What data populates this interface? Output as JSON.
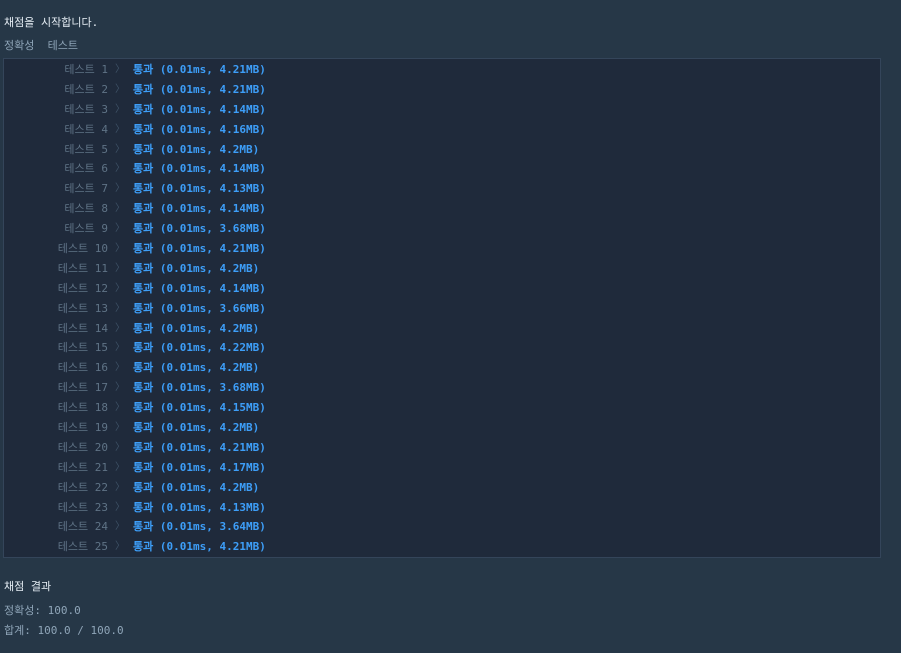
{
  "header": "채점을 시작합니다.",
  "section_label": "정확성  테스트",
  "chevron_icon": "chevron-right-icon",
  "tests": [
    {
      "label": "테스트 1",
      "result": "통과 (0.01ms, 4.21MB)"
    },
    {
      "label": "테스트 2",
      "result": "통과 (0.01ms, 4.21MB)"
    },
    {
      "label": "테스트 3",
      "result": "통과 (0.01ms, 4.14MB)"
    },
    {
      "label": "테스트 4",
      "result": "통과 (0.01ms, 4.16MB)"
    },
    {
      "label": "테스트 5",
      "result": "통과 (0.01ms, 4.2MB)"
    },
    {
      "label": "테스트 6",
      "result": "통과 (0.01ms, 4.14MB)"
    },
    {
      "label": "테스트 7",
      "result": "통과 (0.01ms, 4.13MB)"
    },
    {
      "label": "테스트 8",
      "result": "통과 (0.01ms, 4.14MB)"
    },
    {
      "label": "테스트 9",
      "result": "통과 (0.01ms, 3.68MB)"
    },
    {
      "label": "테스트 10",
      "result": "통과 (0.01ms, 4.21MB)"
    },
    {
      "label": "테스트 11",
      "result": "통과 (0.01ms, 4.2MB)"
    },
    {
      "label": "테스트 12",
      "result": "통과 (0.01ms, 4.14MB)"
    },
    {
      "label": "테스트 13",
      "result": "통과 (0.01ms, 3.66MB)"
    },
    {
      "label": "테스트 14",
      "result": "통과 (0.01ms, 4.2MB)"
    },
    {
      "label": "테스트 15",
      "result": "통과 (0.01ms, 4.22MB)"
    },
    {
      "label": "테스트 16",
      "result": "통과 (0.01ms, 4.2MB)"
    },
    {
      "label": "테스트 17",
      "result": "통과 (0.01ms, 3.68MB)"
    },
    {
      "label": "테스트 18",
      "result": "통과 (0.01ms, 4.15MB)"
    },
    {
      "label": "테스트 19",
      "result": "통과 (0.01ms, 4.2MB)"
    },
    {
      "label": "테스트 20",
      "result": "통과 (0.01ms, 4.21MB)"
    },
    {
      "label": "테스트 21",
      "result": "통과 (0.01ms, 4.17MB)"
    },
    {
      "label": "테스트 22",
      "result": "통과 (0.01ms, 4.2MB)"
    },
    {
      "label": "테스트 23",
      "result": "통과 (0.01ms, 4.13MB)"
    },
    {
      "label": "테스트 24",
      "result": "통과 (0.01ms, 3.64MB)"
    },
    {
      "label": "테스트 25",
      "result": "통과 (0.01ms, 4.21MB)"
    }
  ],
  "summary": {
    "title": "채점 결과",
    "accuracy": "정확성: 100.0",
    "total": "합계: 100.0 / 100.0"
  }
}
